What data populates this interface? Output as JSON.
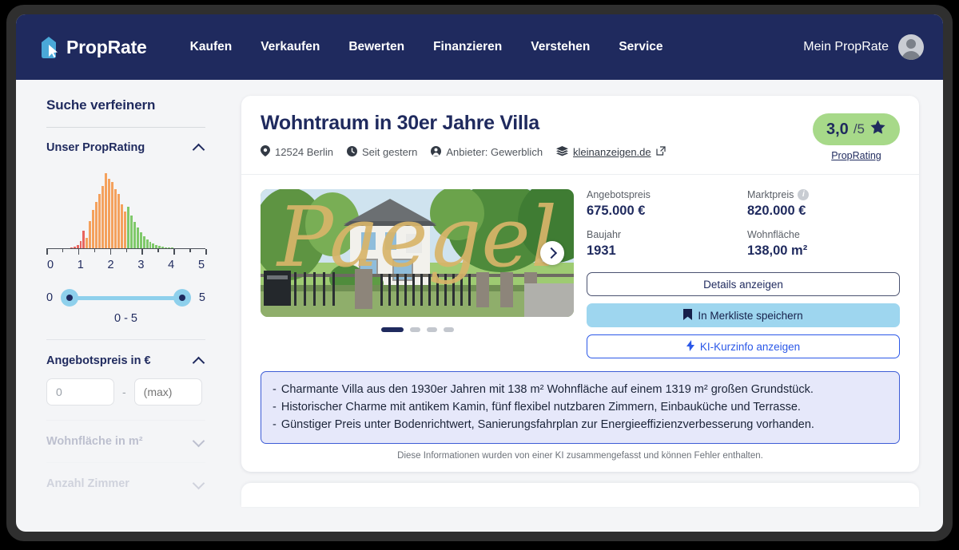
{
  "brand": {
    "name": "PropRate",
    "logo_icon": "house-pin-cursor-icon"
  },
  "nav": {
    "links": [
      "Kaufen",
      "Verkaufen",
      "Bewerten",
      "Finanzieren",
      "Verstehen",
      "Service"
    ],
    "account_label": "Mein PropRate",
    "avatar_icon": "user-avatar-icon"
  },
  "sidebar": {
    "title": "Suche verfeinern",
    "filters": [
      {
        "label": "Unser PropRating",
        "expanded": true,
        "chevron": "chevron-up-icon"
      },
      {
        "label": "Angebotspreis in €",
        "expanded": true,
        "chevron": "chevron-up-icon"
      },
      {
        "label": "Wohnfläche in m²",
        "expanded": false,
        "chevron": "chevron-down-icon"
      },
      {
        "label": "Anzahl Zimmer",
        "expanded": false,
        "chevron": "chevron-down-icon"
      }
    ],
    "slider": {
      "min_label": "0",
      "max_label": "5",
      "value_label": "0 - 5"
    },
    "price_inputs": {
      "min_value": "0",
      "max_placeholder": "(max)",
      "separator": "-"
    }
  },
  "chart_data": {
    "type": "bar",
    "title": "Unser PropRating",
    "xlabel": "",
    "ylabel": "",
    "xlim": [
      0,
      5
    ],
    "grid": false,
    "tick_labels": [
      "0",
      "1",
      "2",
      "3",
      "4",
      "5"
    ],
    "bin_width": 0.1,
    "x": [
      0.05,
      0.15,
      0.25,
      0.35,
      0.45,
      0.55,
      0.65,
      0.75,
      0.85,
      0.95,
      1.05,
      1.15,
      1.25,
      1.35,
      1.45,
      1.55,
      1.65,
      1.75,
      1.85,
      1.95,
      2.05,
      2.15,
      2.25,
      2.35,
      2.45,
      2.55,
      2.65,
      2.75,
      2.85,
      2.95,
      3.05,
      3.15,
      3.25,
      3.35,
      3.45,
      3.55,
      3.65,
      3.75,
      3.85,
      3.95,
      4.05,
      4.15,
      4.25,
      4.35,
      4.45,
      4.55,
      4.65,
      4.75,
      4.85,
      4.95
    ],
    "values": [
      0,
      0,
      0,
      0,
      0,
      0,
      0,
      1,
      2,
      4,
      9,
      22,
      13,
      34,
      48,
      58,
      68,
      78,
      94,
      87,
      83,
      74,
      68,
      55,
      46,
      52,
      41,
      33,
      26,
      20,
      15,
      11,
      8,
      6,
      4,
      3,
      2,
      1,
      1,
      1,
      0,
      0,
      0,
      0,
      0,
      0,
      0,
      0,
      0,
      0
    ],
    "colors": [
      "#e8645e",
      "#f4a15d",
      "#7fc96a"
    ],
    "color_breaks": [
      1.2,
      2.5
    ]
  },
  "listing": {
    "title": "Wohntraum in 30er Jahre Villa",
    "meta": [
      {
        "icon": "map-pin-icon",
        "text": "12524 Berlin"
      },
      {
        "icon": "clock-icon",
        "text": "Seit gestern"
      },
      {
        "icon": "person-icon",
        "text": "Anbieter: Gewerblich"
      },
      {
        "icon": "layers-icon",
        "text": "kleinanzeigen.de",
        "link": true,
        "trailing_icon": "external-link-icon"
      }
    ],
    "rating": {
      "value": "3,0",
      "max": "/5",
      "star_icon": "star-icon",
      "link_label": "PropRating"
    },
    "photo": {
      "watermark": "Paegel",
      "next_icon": "chevron-right-icon",
      "dots": 4,
      "active_dot": 0
    },
    "facts": [
      {
        "label": "Angebotspreis",
        "value": "675.000 €",
        "info": false
      },
      {
        "label": "Marktpreis",
        "value": "820.000 €",
        "info": true,
        "info_icon": "info-icon"
      },
      {
        "label": "Baujahr",
        "value": "1931",
        "info": false
      },
      {
        "label": "Wohnfläche",
        "value": "138,00 m²",
        "info": false
      }
    ],
    "buttons": [
      {
        "label": "Details anzeigen",
        "style": "outline",
        "icon": null
      },
      {
        "label": "In Merkliste speichern",
        "style": "blue",
        "icon": "bookmark-icon"
      },
      {
        "label": "KI-Kurzinfo anzeigen",
        "style": "ai",
        "icon": "lightning-bolt-icon"
      }
    ],
    "ai_summary": {
      "bullets": [
        "Charmante Villa aus den 1930er Jahren mit 138 m² Wohnfläche auf einem 1319 m² großen Grundstück.",
        "Historischer Charme mit antikem Kamin, fünf flexibel nutzbaren Zimmern, Einbauküche und Terrasse.",
        "Günstiger Preis unter Bodenrichtwert, Sanierungsfahrplan zur Energieeffizienzverbesserung vorhanden."
      ],
      "dash": "-",
      "footer": "Diese Informationen wurden von einer KI zusammengefasst und können Fehler enthalten."
    }
  },
  "colors": {
    "navy": "#1f2a5e",
    "green_badge": "#a7d989",
    "light_blue": "#9ed6ef",
    "ai_blue": "#2b58e8",
    "page_bg": "#f4f5f7"
  }
}
